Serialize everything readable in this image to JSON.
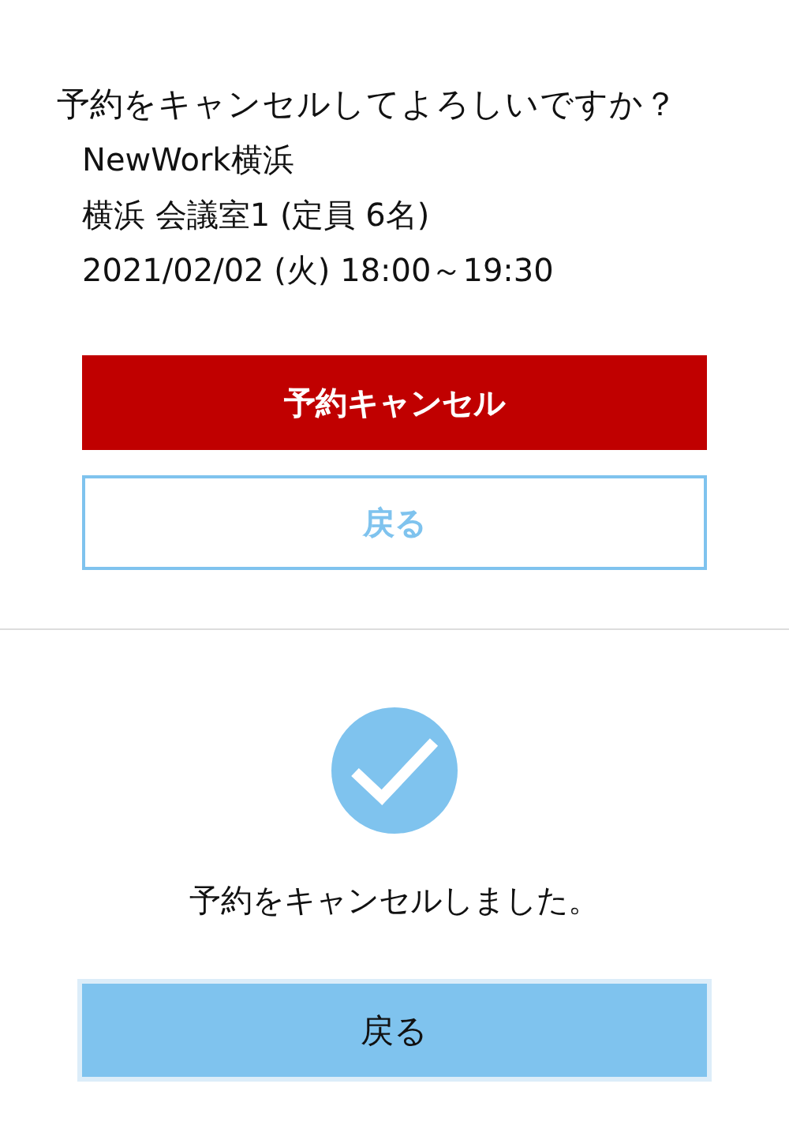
{
  "confirm": {
    "question": "予約をキャンセルしてよろしいですか？",
    "details": [
      "NewWork横浜",
      "横浜 会議室1 (定員 6名)",
      "2021/02/02 (火) 18:00～19:30"
    ],
    "cancel_button": "予約キャンセル",
    "back_button": "戻る"
  },
  "done": {
    "message": "予約をキャンセルしました。",
    "back_button": "戻る"
  }
}
